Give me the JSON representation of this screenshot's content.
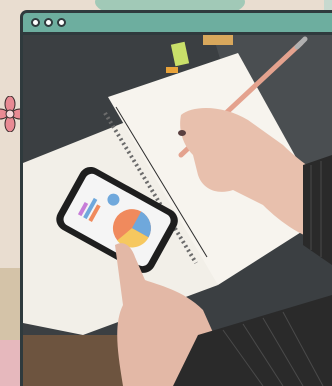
{
  "window": {
    "controls": [
      "close",
      "minimize",
      "maximize"
    ]
  },
  "photo": {
    "subject": "hands-writing-notebook-phone-chart"
  },
  "colors": {
    "titlebar": "#6dae9f",
    "frame": "#2f3a3d",
    "desk": "#3b3f42",
    "notebook": "#f4f1ea",
    "sleeve": "#2b2b2b"
  }
}
